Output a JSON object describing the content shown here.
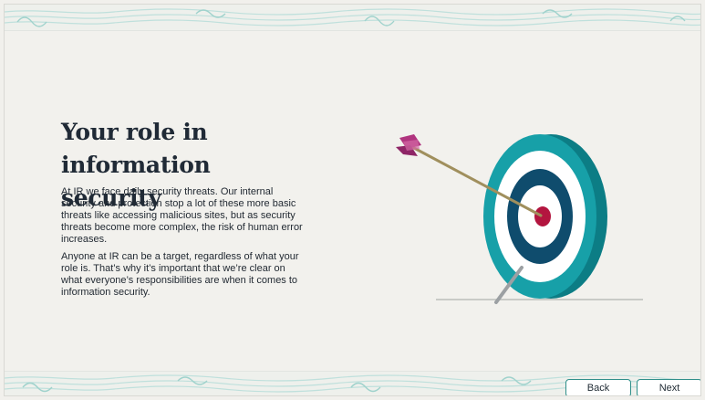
{
  "slide": {
    "heading": "Your role in information security",
    "paragraphs": [
      "At IR we face daily security threats. Our internal security and protection stop a lot of these more basic threats like accessing malicious sites, but as security threats become more complex, the risk of human error increases.",
      "Anyone at IR can be a target, regardless of what your role is. That’s why it’s important that we’re clear on what everyone’s responsibilities are when it comes to information security."
    ]
  },
  "navigation": {
    "back_label": "Back",
    "next_label": "Next"
  },
  "icons": {
    "illustration": "target-arrow-icon"
  },
  "colors": {
    "background": "#f2f1ed",
    "heading": "#202a36",
    "target_teal": "#17a0a8",
    "target_navy": "#0f4c6d",
    "bullseye": "#b3153f",
    "arrow_fletching": "#b0347e",
    "button_border": "#2f8f8a"
  }
}
